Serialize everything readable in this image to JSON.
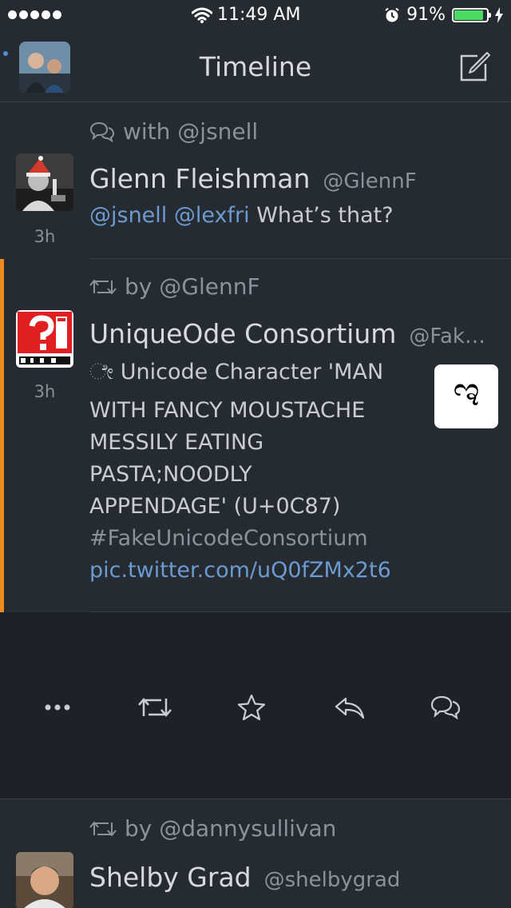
{
  "status_bar": {
    "signal_dots": 5,
    "time": "11:49 AM",
    "battery_percent": "91%",
    "battery_level": 0.91
  },
  "nav": {
    "title": "Timeline"
  },
  "tweets": [
    {
      "context": "with @jsnell",
      "name": "Glenn Fleishman",
      "handle": "@GlennF",
      "time": "3h",
      "mention1": "@jsnell",
      "mention2": "@lexfri",
      "text": "What’s that?"
    },
    {
      "context": "by @GlennF",
      "name": "UniqueOde Consortium",
      "handle": "@Fak…",
      "time": "3h",
      "line1": "ೇ Unicode Character 'MAN",
      "line2": "WITH FANCY MOUSTACHE",
      "line3": "MESSILY EATING",
      "line4": "PASTA;NOODLY",
      "line5": "APPENDAGE' (U+0C87)",
      "hashtag": "#FakeUnicodeConsortium",
      "link": "pic.twitter.com/uQ0fZMx2t6",
      "thumbnail_glyph": "ಇ"
    },
    {
      "context": "by @dannysullivan",
      "name": "Shelby Grad",
      "handle": "@shelbygrad"
    }
  ],
  "actions": [
    {
      "name": "more",
      "icon": "more-icon"
    },
    {
      "name": "retweet",
      "icon": "retweet-icon"
    },
    {
      "name": "favorite",
      "icon": "star-icon"
    },
    {
      "name": "reply",
      "icon": "reply-icon"
    },
    {
      "name": "conversation",
      "icon": "conversation-icon"
    }
  ],
  "colors": {
    "background": "#262a31",
    "link": "#6b9bd1",
    "selected_accent": "#f0891e",
    "battery": "#4cd964"
  }
}
